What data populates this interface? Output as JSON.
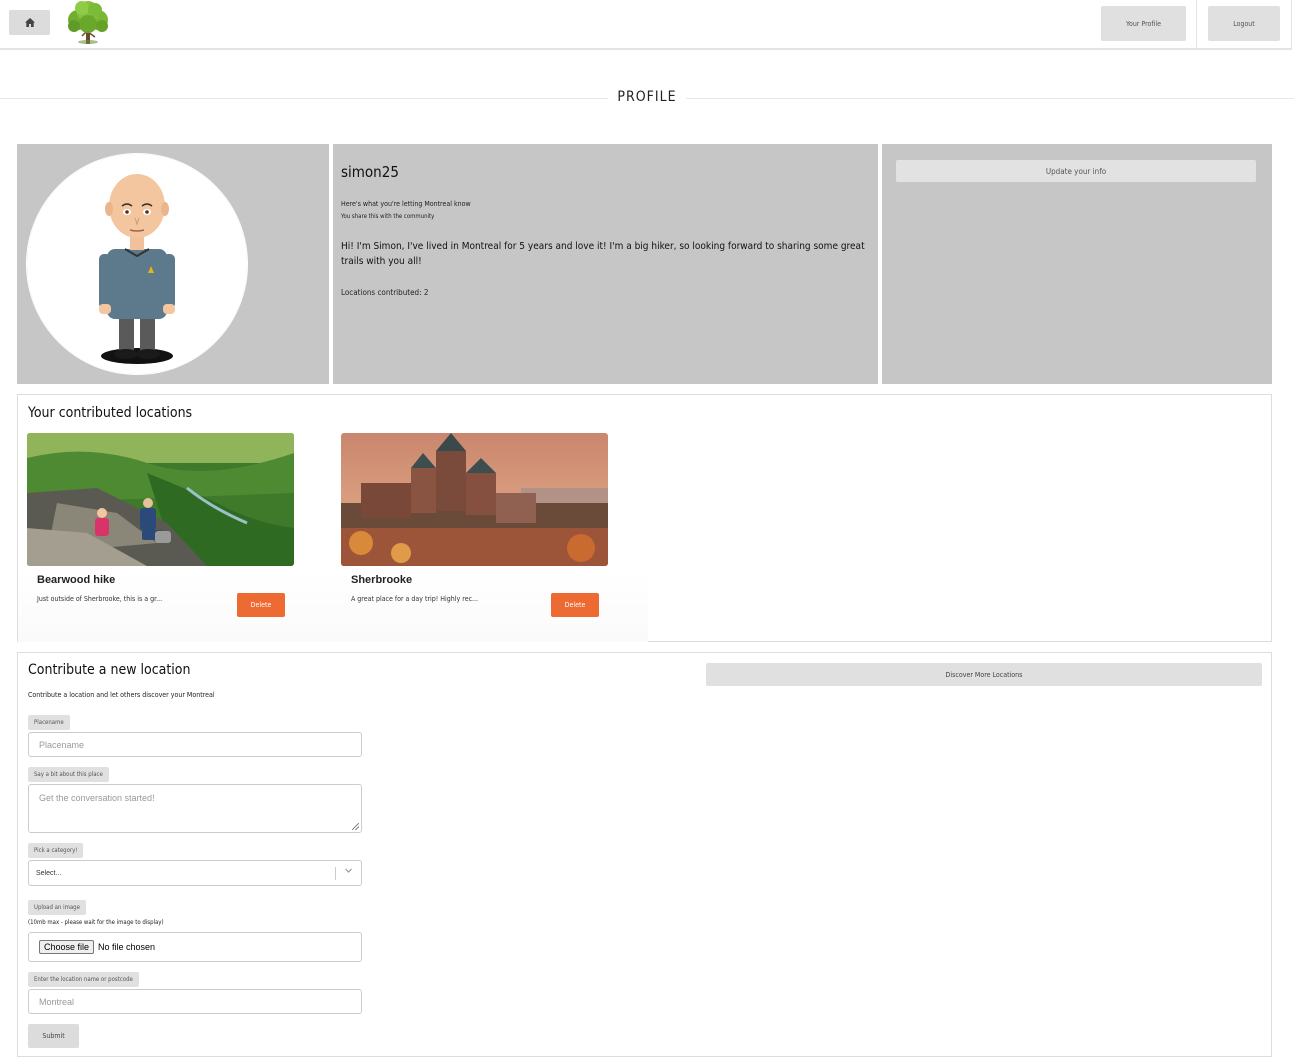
{
  "nav": {
    "home_icon": "home-icon",
    "logo": "tree-logo",
    "profile_label": "Your Profile",
    "logout_label": "Logout"
  },
  "page": {
    "title": "PROFILE"
  },
  "profile": {
    "username": "simon25",
    "sharing_heading": "Here's what you're letting Montreal know",
    "sharing_sub": "You share this with the community",
    "bio": "Hi! I'm Simon, I've lived in Montreal for 5 years and love it! I'm a big hiker, so looking forward to sharing some great trails with you all!",
    "locations_label": "Locations contributed: 2",
    "update_label": "Update your info"
  },
  "contributed": {
    "heading": "Your contributed locations",
    "cards": [
      {
        "name": "Bearwood hike",
        "desc": "Just outside of Sherbrooke, this is a gr...",
        "delete_label": "Delete"
      },
      {
        "name": "Sherbrooke",
        "desc": "A great place for a day trip! Highly rec...",
        "delete_label": "Delete"
      }
    ]
  },
  "form": {
    "heading": "Contribute a new location",
    "subheading": "Contribute a location and let others discover your Montreal",
    "discover_label": "Discover More Locations",
    "placename_label": "Placename",
    "placename_placeholder": "Placename",
    "about_label": "Say a bit about this place",
    "about_placeholder": "Get the conversation started!",
    "category_label": "Pick a category!",
    "category_value": "Select...",
    "upload_label": "Upload an image",
    "upload_note": "(10mb max - please wait for the image to display)",
    "file_button": "Choose file",
    "file_status": "No file chosen",
    "location_label": "Enter the location name or postcode",
    "location_placeholder": "Montreal",
    "submit_label": "Submit"
  }
}
